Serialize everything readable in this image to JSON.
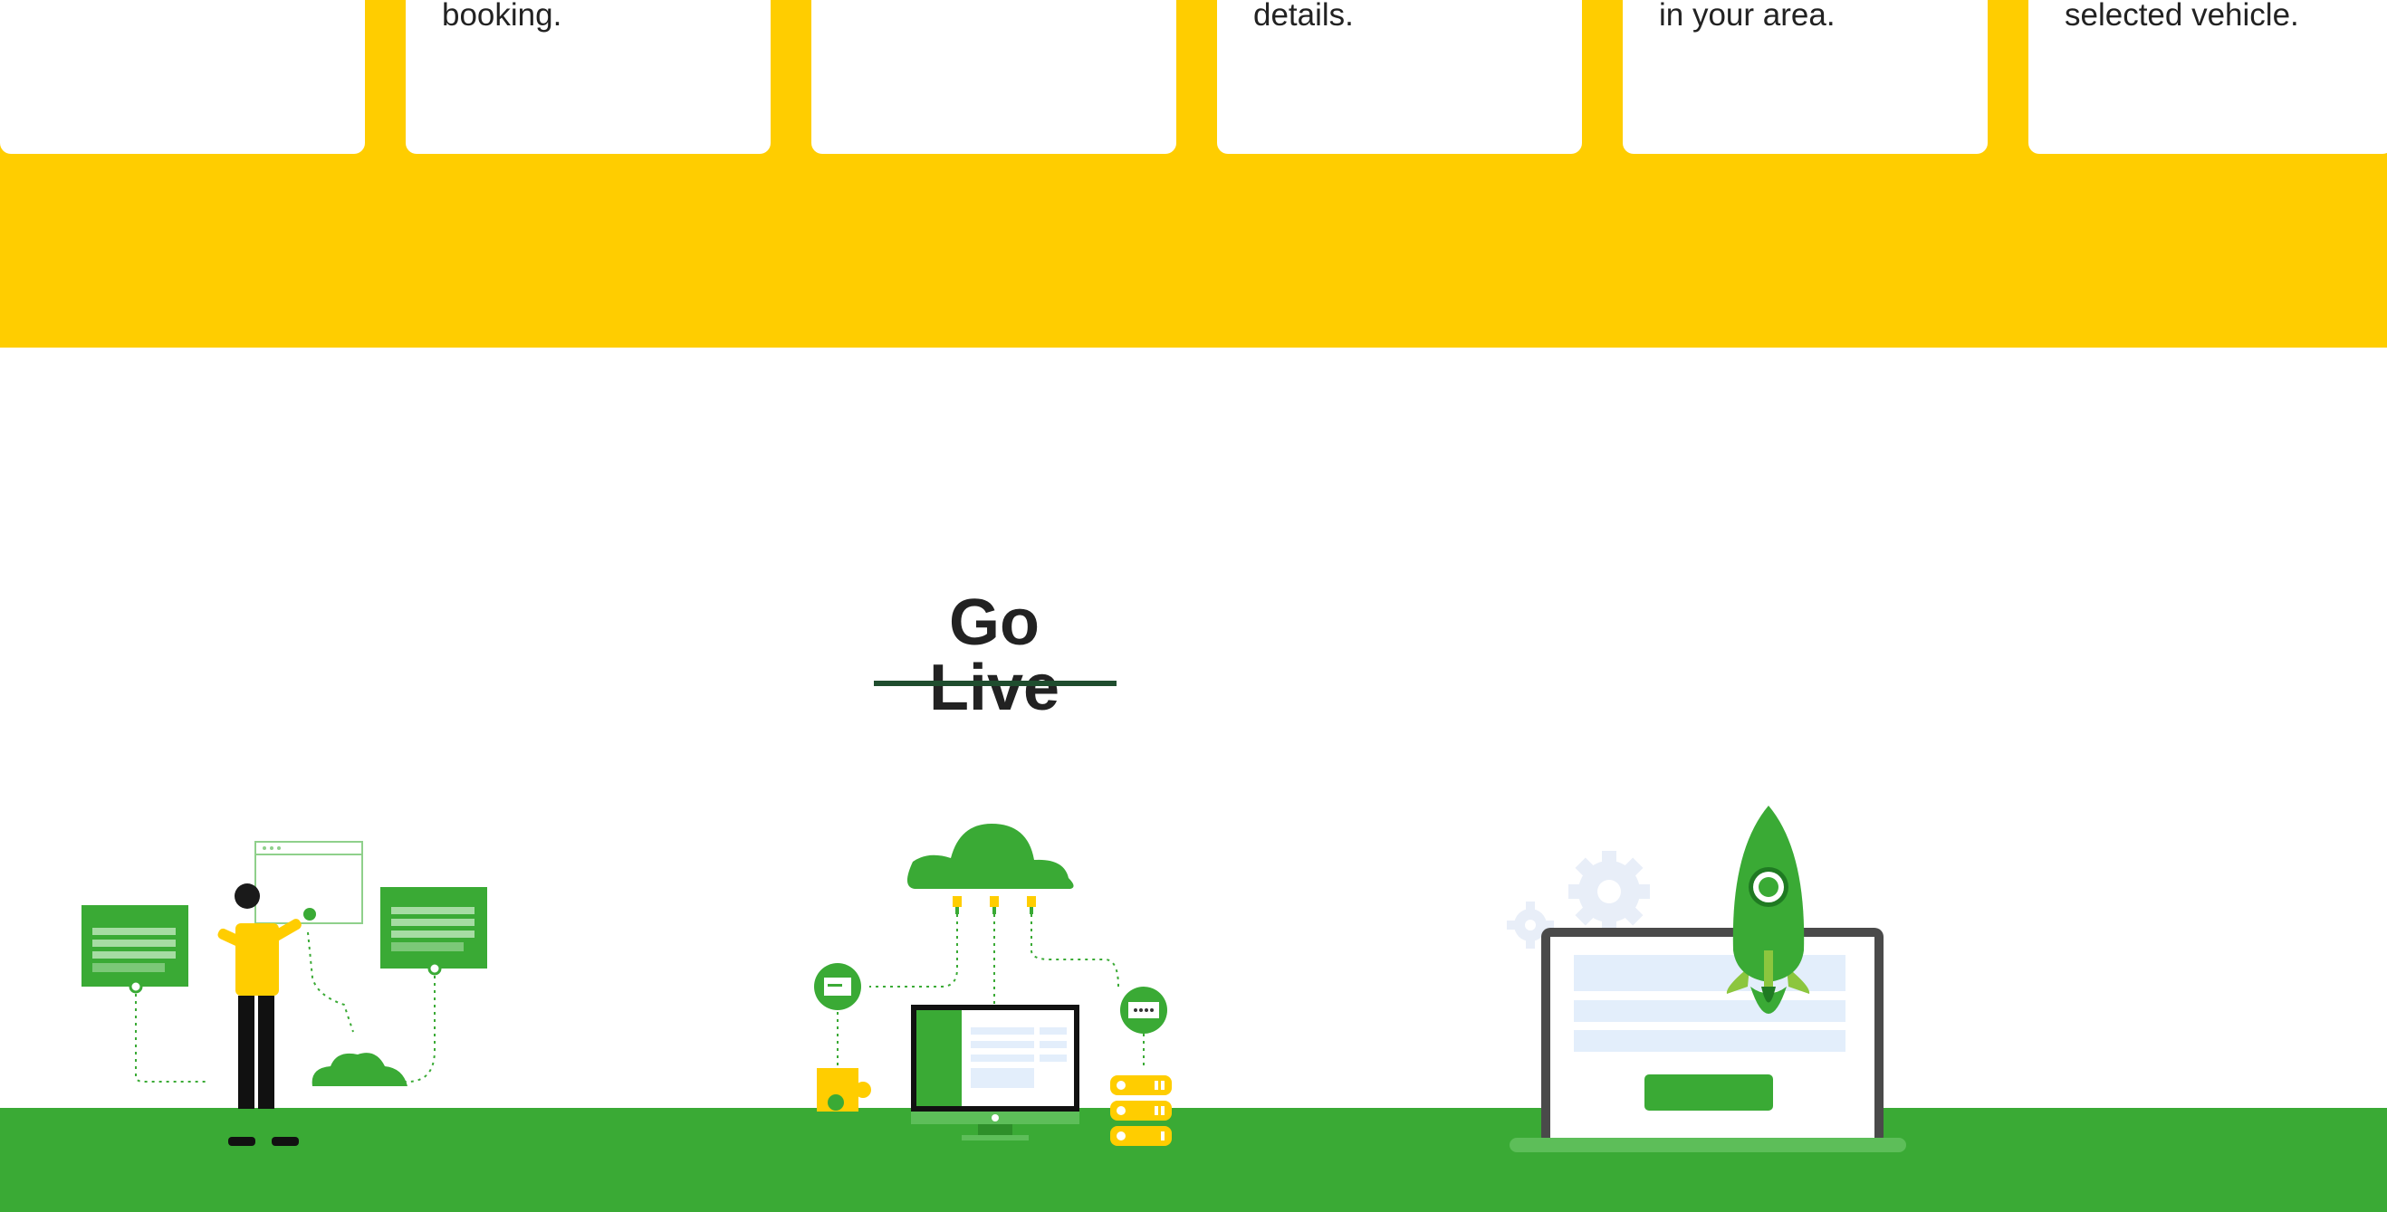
{
  "cards": [
    {
      "text": ""
    },
    {
      "text": "booking."
    },
    {
      "text": ""
    },
    {
      "text": "details."
    },
    {
      "text": "in your area."
    },
    {
      "text": "selected vehicle."
    }
  ],
  "section": {
    "title": "Go Live"
  },
  "colors": {
    "brand_yellow": "#FFCD00",
    "brand_green": "#3AAA35",
    "title_underline": "#1F4D2E"
  },
  "illustrations": [
    {
      "name": "developer-illustration"
    },
    {
      "name": "cloud-server-illustration"
    },
    {
      "name": "rocket-launch-illustration"
    }
  ]
}
